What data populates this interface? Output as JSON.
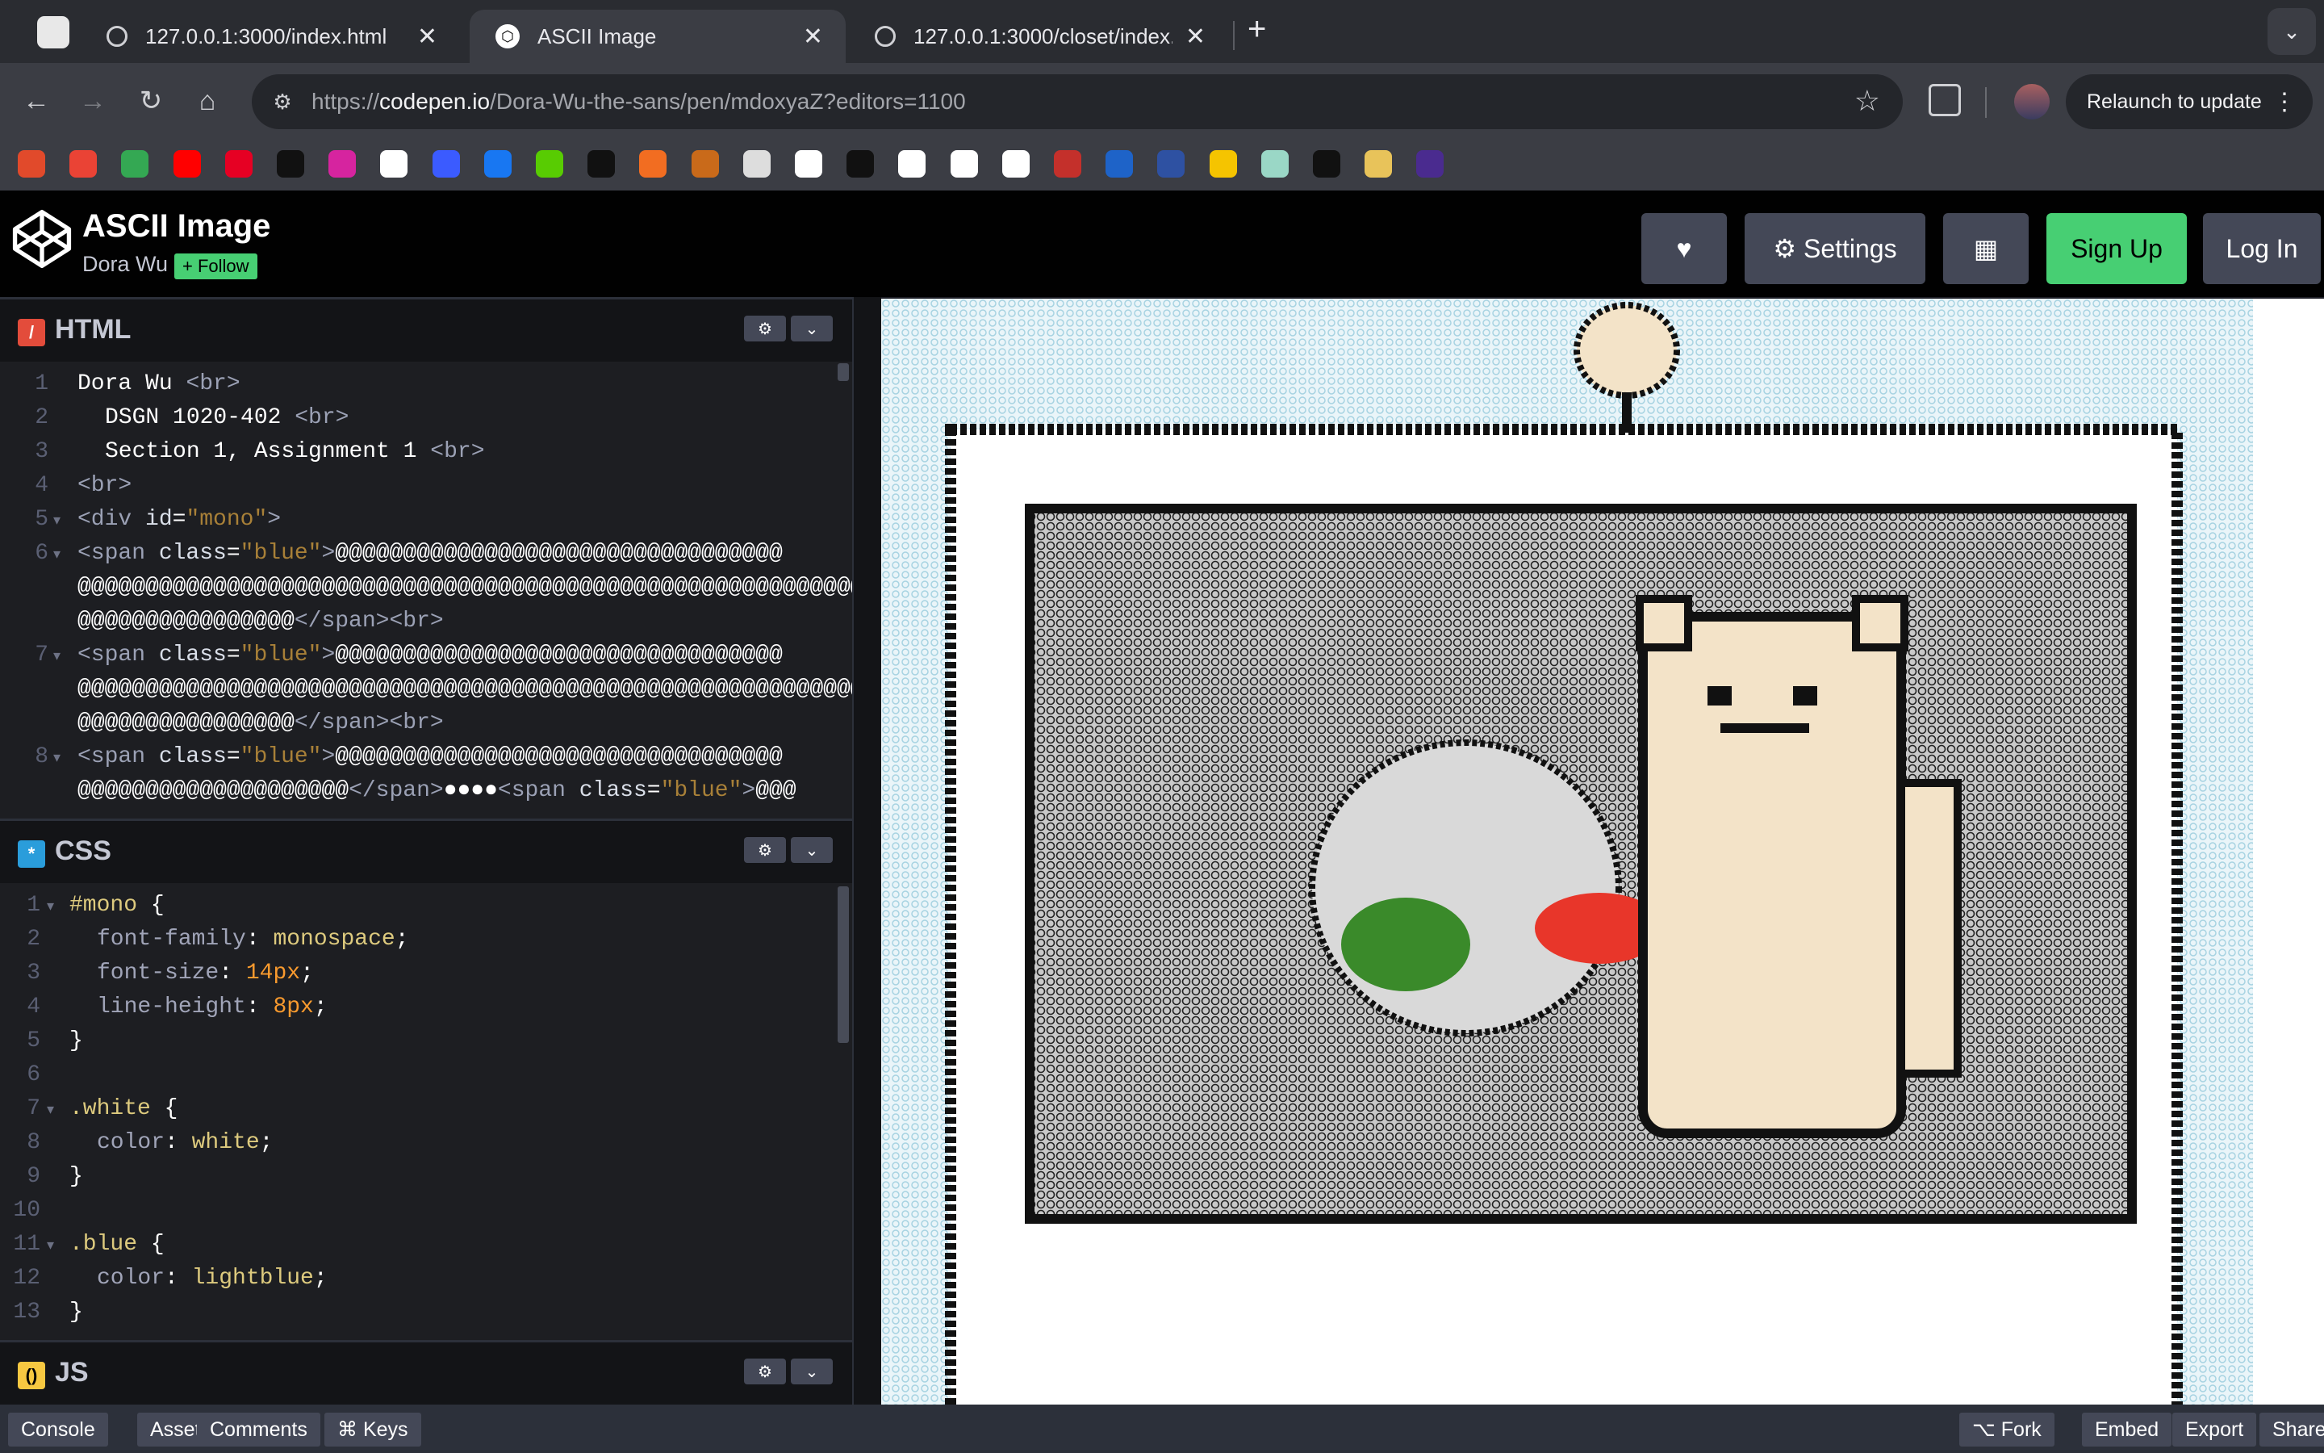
{
  "browser": {
    "tabs": [
      {
        "title": "127.0.0.1:3000/index.html"
      },
      {
        "title": "ASCII Image"
      },
      {
        "title": "127.0.0.1:3000/closet/index."
      }
    ],
    "tab_close": "✕",
    "new_tab": "+",
    "url_prefix": "https://",
    "url_domain": "codepen.io",
    "url_path": "/Dora-Wu-the-sans/pen/mdoxyaZ?editors=1100",
    "relaunch_label": "Relaunch to update"
  },
  "bookmarks": {
    "colors": [
      "#e14a2b",
      "#ea4335",
      "#34a853",
      "#ff0000",
      "#e60023",
      "#111111",
      "#d6249f",
      "#ffffff",
      "#3b5bff",
      "#1877f2",
      "#58cc02",
      "#111111",
      "#f26d21",
      "#c96a1a",
      "#dddddd",
      "#ffffff",
      "#111111",
      "#ffffff",
      "#ffffff",
      "#ffffff",
      "#c4302b",
      "#1e63c8",
      "#2e51a2",
      "#f5c400",
      "#9ad7c6",
      "#111111",
      "#e8c35a",
      "#4a2b8f"
    ]
  },
  "codepen": {
    "title": "ASCII Image",
    "author": "Dora Wu",
    "follow_label": "Follow",
    "settings_label": "Settings",
    "signup_label": "Sign Up",
    "login_label": "Log In"
  },
  "panels": {
    "html_title": "HTML",
    "css_title": "CSS",
    "js_title": "JS"
  },
  "html_code": {
    "l1": "Dora Wu",
    "l2": "DSGN 1020-402",
    "l3": "Section 1, Assignment 1",
    "div_id": "\"mono\"",
    "span_class": "\"blue\"",
    "ascii_long": "@@@@@@@@@@@@@@@@@@@@@@@@@@@@@@@@@",
    "ascii_mid": "@@@@@@@@@@@@@@@@@@@@",
    "ascii_short": "@@@@@@@@@@@@@@@@",
    "ascii_sep": "●●●●"
  },
  "css_code": {
    "sel_mono": "#mono",
    "ff_prop": "font-family",
    "ff_val": "monospace",
    "fs_prop": "font-size",
    "fs_val": "14px",
    "lh_prop": "line-height",
    "lh_val": "8px",
    "sel_white": ".white",
    "color_prop": "color",
    "white_val": "white",
    "sel_blue": ".blue",
    "blue_val": "lightblue"
  },
  "footer": {
    "console": "Console",
    "assets": "Assets",
    "comments": "Comments",
    "keys": "⌘ Keys",
    "fork": "Fork",
    "embed": "Embed",
    "export": "Export",
    "share": "Share"
  },
  "preview_colors": {
    "frame_bg": "#cfe7f0",
    "dark": "#111111",
    "cat": "#f3e3c8",
    "bowl": "#d9d9d9",
    "red": "#e8362a",
    "green": "#3a8a2a"
  }
}
